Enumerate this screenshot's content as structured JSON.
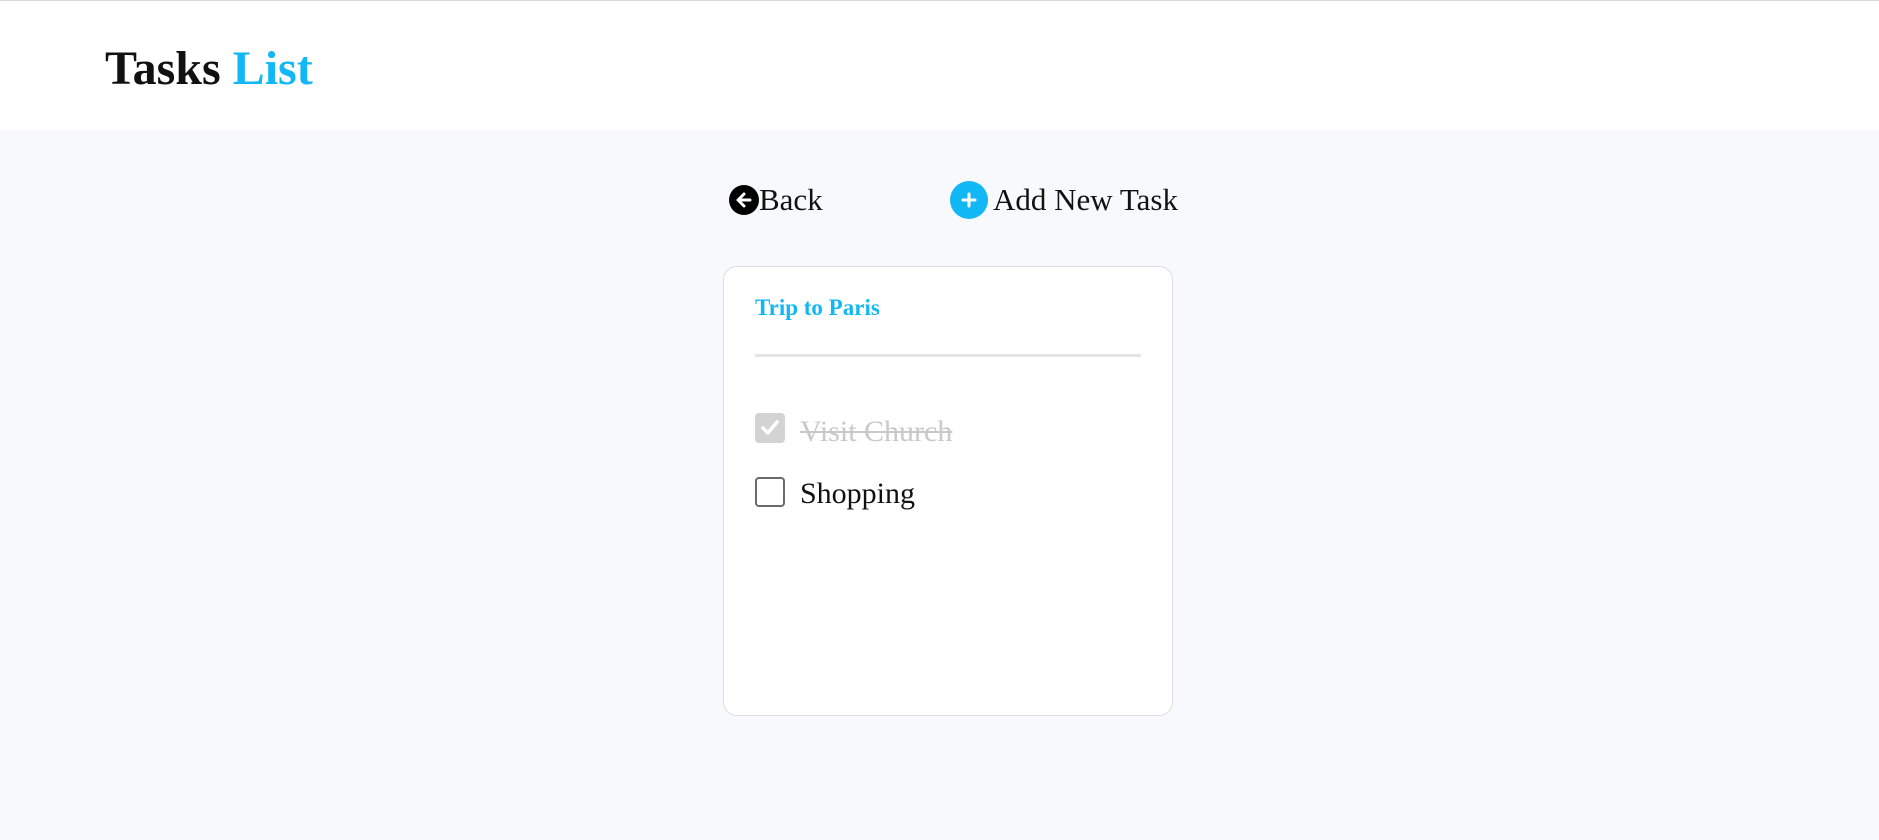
{
  "header": {
    "title_main": "Tasks",
    "title_accent": "List"
  },
  "actions": {
    "back_label": "Back",
    "back_icon": "arrow-left-circle-icon",
    "add_label": "Add New Task",
    "add_icon": "plus-circle-icon"
  },
  "card": {
    "title": "Trip to Paris",
    "tasks": [
      {
        "label": "Visit Church",
        "completed": true
      },
      {
        "label": "Shopping",
        "completed": false
      }
    ]
  },
  "colors": {
    "accent": "#12b8f5",
    "page_background": "#f7f9fc",
    "card_background": "#ffffff",
    "completed_text": "#c9c9c9",
    "checkbox_checked": "#d3d3d3"
  }
}
